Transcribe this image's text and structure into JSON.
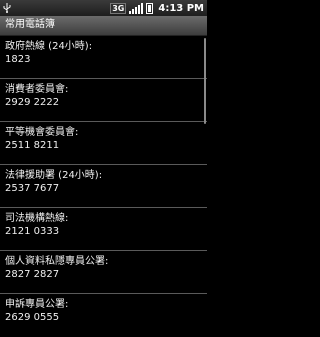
{
  "status_bar": {
    "network_badge": "3G",
    "time": "4:13 PM",
    "icons": [
      "usb-icon",
      "network-3g-icon",
      "signal-icon",
      "battery-icon"
    ]
  },
  "app": {
    "title": "常用電話簿"
  },
  "contacts": [
    {
      "name": "政府熱線 (24小時):",
      "phone": "1823"
    },
    {
      "name": "消費者委員會:",
      "phone": "2929 2222"
    },
    {
      "name": "平等機會委員會:",
      "phone": "2511 8211"
    },
    {
      "name": "法律援助署 (24小時):",
      "phone": "2537 7677"
    },
    {
      "name": "司法機構熱線:",
      "phone": "2121 0333"
    },
    {
      "name": "個人資料私隱專員公署:",
      "phone": "2827 2827"
    },
    {
      "name": "申訴專員公署:",
      "phone": "2629 0555"
    }
  ]
}
